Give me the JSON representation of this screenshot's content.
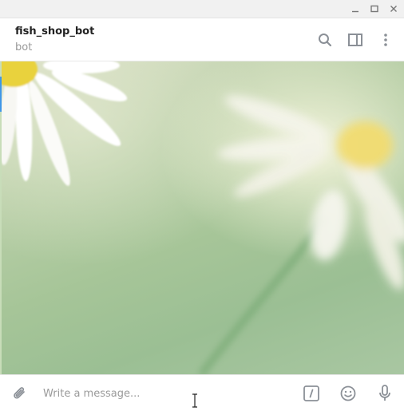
{
  "window": {
    "controls": [
      "minimize-icon",
      "maximize-icon",
      "close-icon"
    ]
  },
  "header": {
    "title": "fish_shop_bot",
    "subtitle": "bot",
    "actions": [
      "search-icon",
      "sidebar-toggle-icon",
      "more-vertical-icon"
    ]
  },
  "chat": {
    "wallpaper": "daisy-flowers",
    "accent_color": "#3f97e8"
  },
  "composer": {
    "placeholder": "Write a message...",
    "value": "",
    "icons": [
      "paperclip-icon",
      "bot-command-icon",
      "emoji-icon",
      "microphone-icon"
    ]
  },
  "colors": {
    "icon": "#8b9097",
    "title": "#222222",
    "subtitle": "#999999"
  }
}
